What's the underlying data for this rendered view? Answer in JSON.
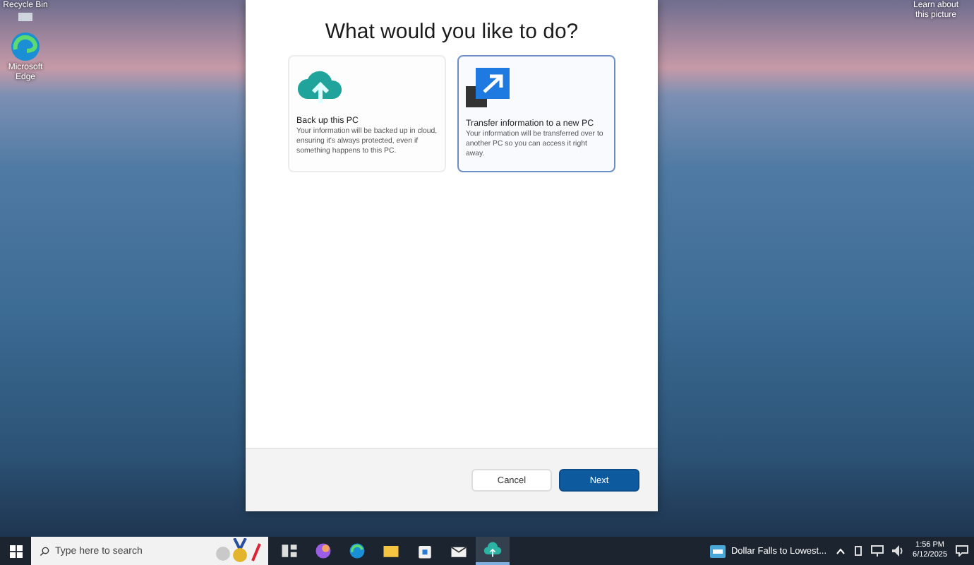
{
  "desktop": {
    "icons": [
      {
        "label": "Recycle Bin",
        "kind": "recycle"
      },
      {
        "label": "Microsoft Edge",
        "kind": "edge"
      }
    ],
    "spotlight_label": "Learn about this picture"
  },
  "dialog": {
    "title": "What would you like to do?",
    "options": [
      {
        "kind": "backup",
        "title": "Back up this PC",
        "description": "Your information will be backed up in cloud, ensuring it's always protected, even if something happens to this PC.",
        "selected": false
      },
      {
        "kind": "transfer",
        "title": "Transfer information to a new PC",
        "description": "Your information will be transferred over to another PC so you can access it right away.",
        "selected": true
      }
    ],
    "buttons": [
      {
        "label": "Cancel",
        "kind": "secondary"
      },
      {
        "label": "Next",
        "kind": "primary"
      }
    ]
  },
  "taskbar": {
    "search": {
      "placeholder": "Type here to search"
    },
    "apps": [
      {
        "kind": "taskview",
        "active": false
      },
      {
        "kind": "copilot",
        "active": false
      },
      {
        "kind": "edge",
        "active": false
      },
      {
        "kind": "explorer",
        "active": false
      },
      {
        "kind": "store",
        "active": false
      },
      {
        "kind": "mail",
        "active": false
      },
      {
        "kind": "backup",
        "active": true
      }
    ],
    "news": "Dollar Falls to Lowest...",
    "time": "1:56 PM",
    "date": "6/12/2025"
  }
}
